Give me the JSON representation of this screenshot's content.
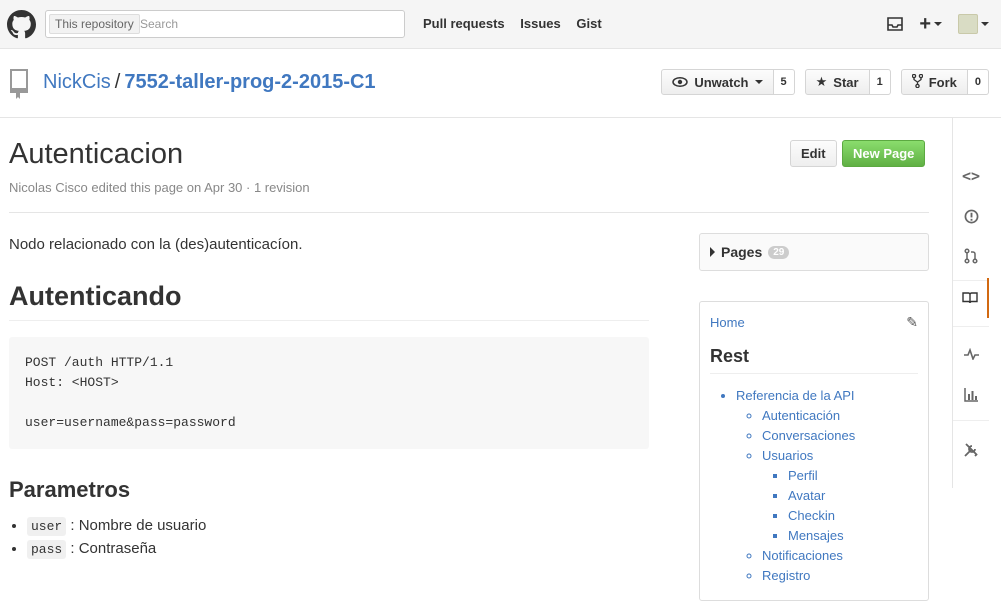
{
  "header": {
    "search": {
      "scope_label": "This repository",
      "placeholder": "Search"
    },
    "nav": [
      "Pull requests",
      "Issues",
      "Gist"
    ]
  },
  "repo": {
    "owner": "NickCis",
    "separator": "/",
    "name": "7552-taller-prog-2-2015-C1",
    "actions": {
      "watch": {
        "label": "Unwatch",
        "count": "5"
      },
      "star": {
        "label": "Star",
        "count": "1"
      },
      "fork": {
        "label": "Fork",
        "count": "0"
      }
    }
  },
  "page": {
    "title": "Autenticacion",
    "meta": "Nicolas Cisco edited this page on Apr 30 · 1 revision",
    "edit_label": "Edit",
    "new_page_label": "New Page",
    "intro": "Nodo relacionado con la (des)autenticacíon.",
    "h1": "Autenticando",
    "code": "POST /auth HTTP/1.1\nHost: <HOST>\n\nuser=username&pass=password",
    "h2": "Parametros",
    "params": [
      {
        "code": "user",
        "desc": ": Nombre de usuario"
      },
      {
        "code": "pass",
        "desc": ": Contraseña"
      }
    ]
  },
  "sidebar": {
    "pages_label": "Pages",
    "pages_count": "29",
    "home": "Home",
    "rest": "Rest",
    "toc": {
      "api": "Referencia de la API",
      "autenticacion": "Autenticación",
      "conversaciones": "Conversaciones",
      "usuarios": "Usuarios",
      "perfil": "Perfil",
      "avatar": "Avatar",
      "checkin": "Checkin",
      "mensajes": "Mensajes",
      "notificaciones": "Notificaciones",
      "registro": "Registro"
    }
  },
  "colors": {
    "link": "#4078c0",
    "green": "#60b044",
    "rail_active": "#d26911"
  }
}
